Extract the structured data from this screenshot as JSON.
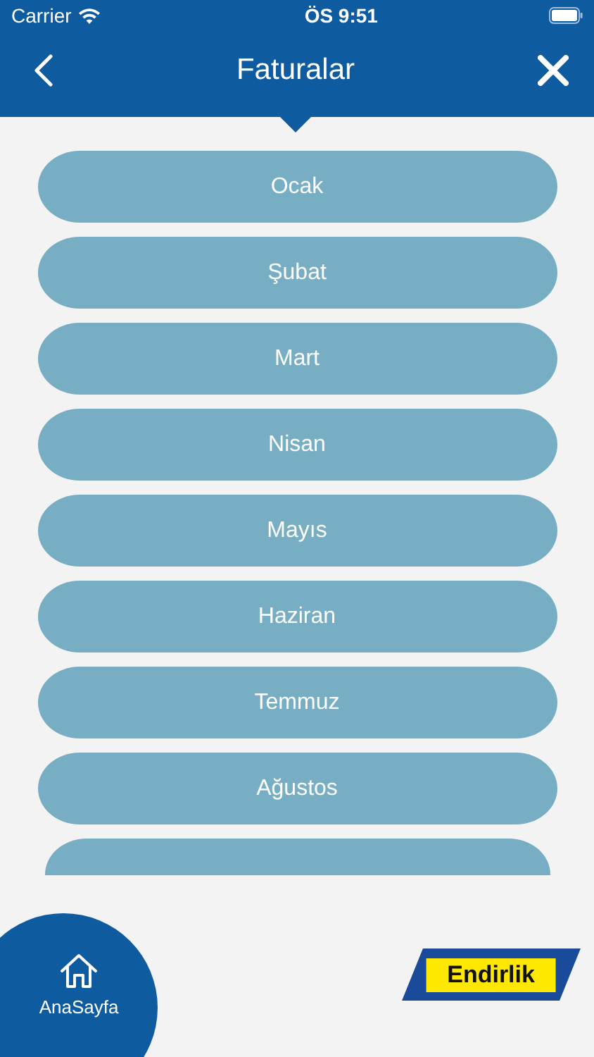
{
  "status_bar": {
    "carrier": "Carrier",
    "time": "ÖS 9:51"
  },
  "nav": {
    "title": "Faturalar"
  },
  "months": [
    "Ocak",
    "Şubat",
    "Mart",
    "Nisan",
    "Mayıs",
    "Haziran",
    "Temmuz",
    "Ağustos"
  ],
  "home": {
    "label": "AnaSayfa"
  },
  "logo": {
    "text": "Endirlik"
  }
}
